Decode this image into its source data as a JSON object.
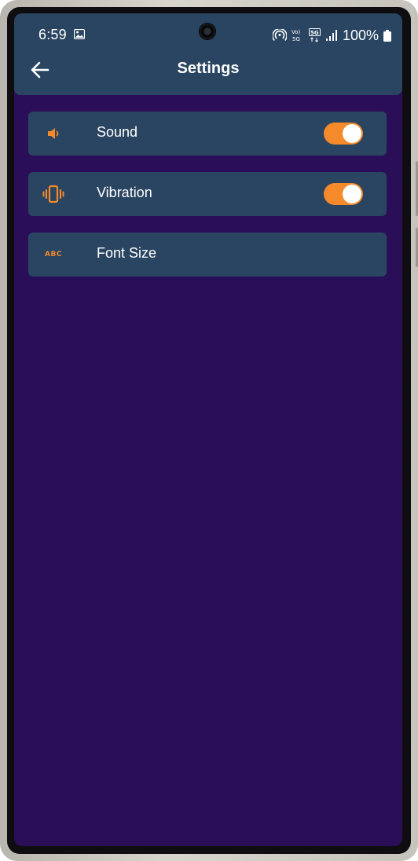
{
  "status_bar": {
    "time": "6:59",
    "battery": "100%",
    "network_label": "5G",
    "volte_label": "Vo) 5G"
  },
  "header": {
    "title": "Settings"
  },
  "settings": {
    "items": [
      {
        "label": "Sound",
        "icon": "speaker-icon",
        "toggle": true,
        "enabled": true
      },
      {
        "label": "Vibration",
        "icon": "vibration-icon",
        "toggle": true,
        "enabled": true
      },
      {
        "label": "Font Size",
        "icon": "abc-text-icon",
        "icon_text": "ABC",
        "toggle": false
      }
    ]
  },
  "colors": {
    "background": "#2a0f58",
    "bar": "#2a4561",
    "accent": "#f48a2a",
    "text": "#ffffff"
  }
}
